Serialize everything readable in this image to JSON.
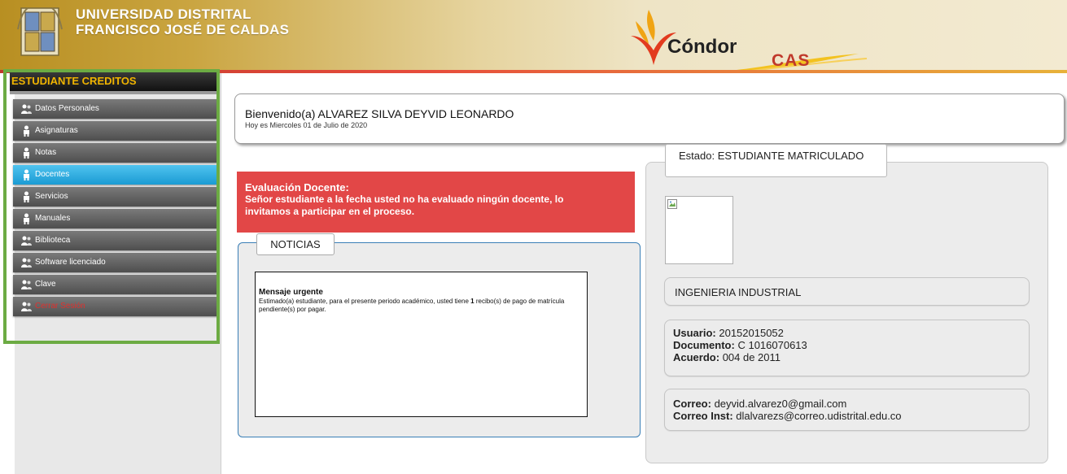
{
  "header": {
    "university_line1": "UNIVERSIDAD DISTRITAL",
    "university_line2": "FRANCISCO JOSÉ DE CALDAS",
    "app_name": "Cóndor",
    "app_suffix": "CAS"
  },
  "sidebar": {
    "title": "ESTUDIANTE CREDITOS",
    "items": [
      {
        "label": "Datos Personales",
        "icon": "users-icon",
        "active": false
      },
      {
        "label": "Asignaturas",
        "icon": "person-icon",
        "active": false
      },
      {
        "label": "Notas",
        "icon": "person-icon",
        "active": false
      },
      {
        "label": "Docentes",
        "icon": "person-icon",
        "active": true
      },
      {
        "label": "Servicios",
        "icon": "person-icon",
        "active": false
      },
      {
        "label": "Manuales",
        "icon": "person-icon",
        "active": false
      },
      {
        "label": "Biblioteca",
        "icon": "users-icon",
        "active": false
      },
      {
        "label": "Software licenciado",
        "icon": "users-icon",
        "active": false
      },
      {
        "label": "Clave",
        "icon": "users-icon",
        "active": false
      },
      {
        "label": "Cerrar Sesión",
        "icon": "users-icon",
        "active": false
      }
    ]
  },
  "welcome": {
    "greeting": "Bienvenido(a) ALVAREZ SILVA DEYVID LEONARDO",
    "date": "Hoy es Miercoles 01 de Julio de 2020"
  },
  "alert": {
    "title": "Evaluación Docente:",
    "body": "Señor estudiante a la fecha usted no ha evaluado ningún docente, lo invitamos a participar en el proceso."
  },
  "news": {
    "tab": "NOTICIAS",
    "title": "Mensaje urgente",
    "body_before": "Estimado(a) estudiante, para el presente periodo académico, usted tiene ",
    "body_count": "1",
    "body_after": " recibo(s) de pago de matrícula pendiente(s) por pagar."
  },
  "student": {
    "status": "Estado: ESTUDIANTE MATRICULADO",
    "program": "INGENIERIA INDUSTRIAL",
    "user_label": "Usuario:",
    "user_value": "20152015052",
    "doc_label": "Documento:",
    "doc_value": "C 1016070613",
    "agreement_label": "Acuerdo:",
    "agreement_value": "004 de 2011",
    "email_label": "Correo:",
    "email_value": "deyvid.alvarez0@gmail.com",
    "inst_email_label": "Correo Inst:",
    "inst_email_value": "dlalvarezs@correo.udistrital.edu.co"
  },
  "colors": {
    "active_item": "#1b9bd3",
    "alert_bg": "#e24747",
    "highlight_frame": "#6cab43",
    "menu_title_text": "#f0b400",
    "logout_text": "#e0312e"
  }
}
